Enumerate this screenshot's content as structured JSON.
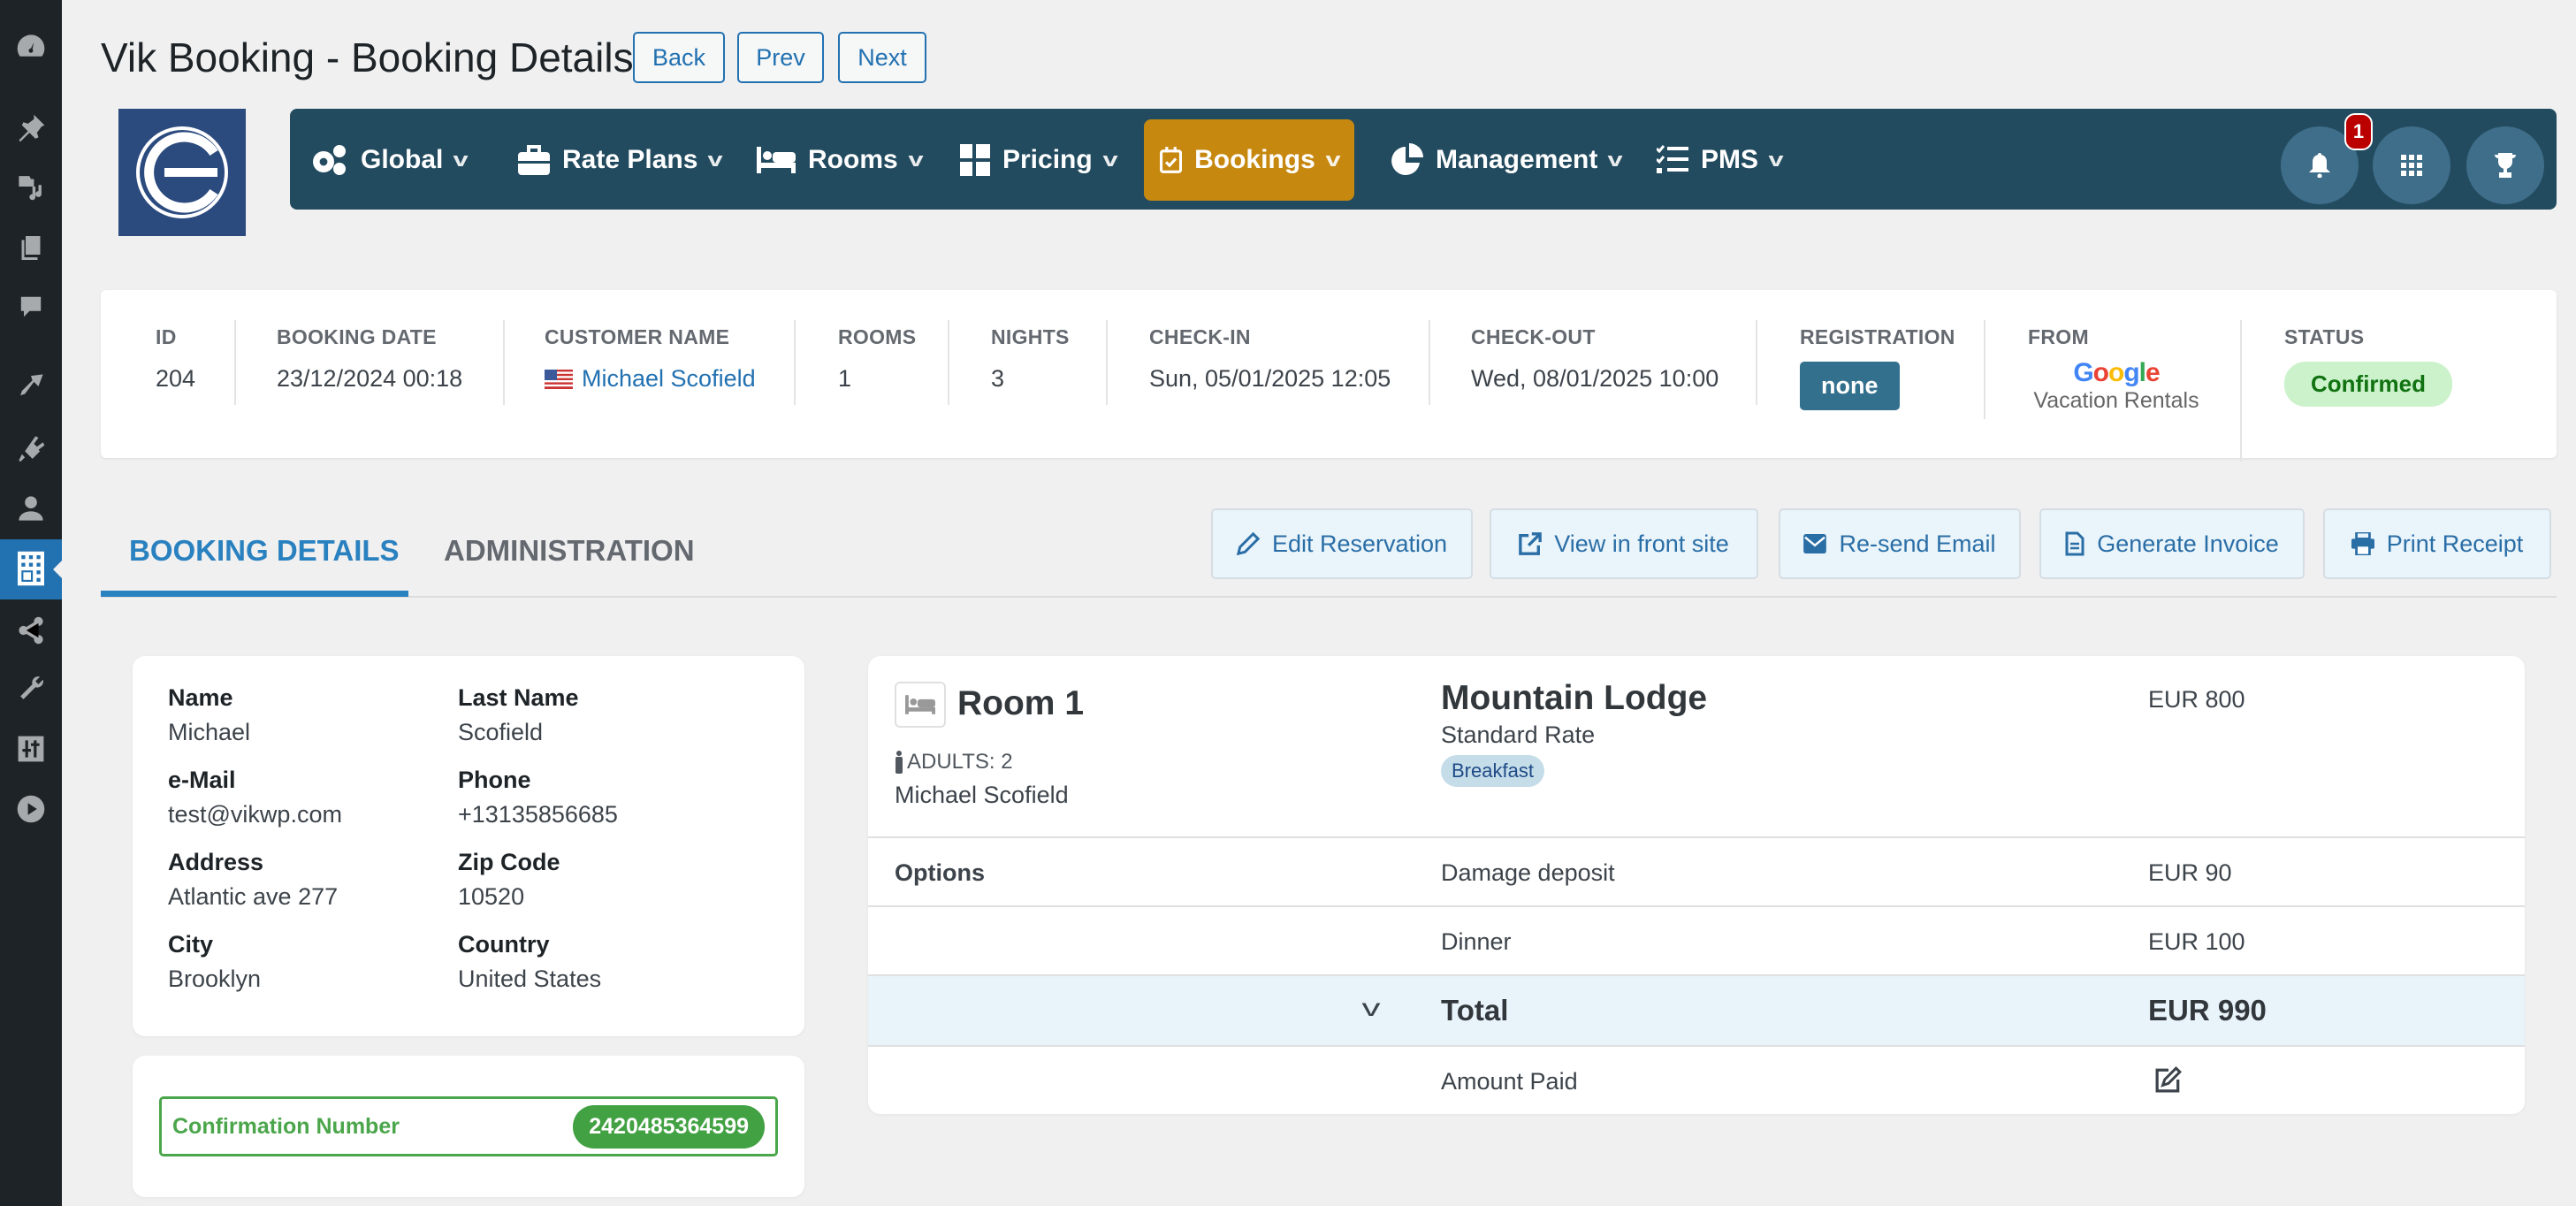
{
  "page": {
    "title": "Vik Booking - Booking Details"
  },
  "header_buttons": {
    "back": "Back",
    "prev": "Prev",
    "next": "Next"
  },
  "wp_sidebar": {
    "icons": [
      "dashboard-icon",
      "pin-icon",
      "media-icon",
      "pages-icon",
      "comments-icon",
      "appearance-icon",
      "plugins-icon",
      "users-icon",
      "vikbooking-icon",
      "share-icon",
      "tools-icon",
      "settings-icon",
      "play-icon"
    ],
    "active": "vikbooking-icon"
  },
  "menu": {
    "items": [
      {
        "label": "Global",
        "icon": "gears-icon"
      },
      {
        "label": "Rate Plans",
        "icon": "briefcase-icon"
      },
      {
        "label": "Rooms",
        "icon": "bed-icon"
      },
      {
        "label": "Pricing",
        "icon": "calculator-icon"
      },
      {
        "label": "Bookings",
        "icon": "calendar-check-icon",
        "active": true
      },
      {
        "label": "Management",
        "icon": "pie-chart-icon"
      },
      {
        "label": "PMS",
        "icon": "checklist-icon"
      }
    ],
    "notification_count": "1",
    "colors": {
      "bar": "#234b5f",
      "active": "#c6880f"
    }
  },
  "summary": {
    "id": {
      "label": "ID",
      "value": "204"
    },
    "booking_date": {
      "label": "BOOKING DATE",
      "value": "23/12/2024 00:18"
    },
    "customer_name": {
      "label": "CUSTOMER NAME",
      "value": "Michael Scofield",
      "flag": "us-flag"
    },
    "rooms": {
      "label": "ROOMS",
      "value": "1"
    },
    "nights": {
      "label": "NIGHTS",
      "value": "3"
    },
    "checkin": {
      "label": "CHECK-IN",
      "value": "Sun, 05/01/2025 12:05"
    },
    "checkout": {
      "label": "CHECK-OUT",
      "value": "Wed, 08/01/2025 10:00"
    },
    "registration": {
      "label": "REGISTRATION",
      "value": "none"
    },
    "from": {
      "label": "FROM",
      "brand": "Google",
      "sub": "Vacation Rentals"
    },
    "status": {
      "label": "STATUS",
      "value": "Confirmed",
      "color": "#117211"
    }
  },
  "tabs": [
    {
      "label": "BOOKING DETAILS",
      "active": true
    },
    {
      "label": "ADMINISTRATION"
    }
  ],
  "actions": {
    "edit": "Edit Reservation",
    "view": "View in front site",
    "resend": "Re-send Email",
    "invoice": "Generate Invoice",
    "print": "Print Receipt"
  },
  "customer": {
    "fields": [
      {
        "label": "Name",
        "value": "Michael"
      },
      {
        "label": "Last Name",
        "value": "Scofield"
      },
      {
        "label": "e-Mail",
        "value": "test@vikwp.com"
      },
      {
        "label": "Phone",
        "value": "+13135856685"
      },
      {
        "label": "Address",
        "value": "Atlantic ave 277"
      },
      {
        "label": "Zip Code",
        "value": "10520"
      },
      {
        "label": "City",
        "value": "Brooklyn"
      },
      {
        "label": "Country",
        "value": "United States"
      }
    ],
    "confirmation": {
      "label": "Confirmation Number",
      "value": "2420485364599"
    }
  },
  "room": {
    "title": "Room 1",
    "adults": "ADULTS: 2",
    "guest": "Michael Scofield",
    "name": "Mountain Lodge",
    "rate": "Standard Rate",
    "tag": "Breakfast",
    "price": "EUR 800",
    "options_label": "Options",
    "options": [
      {
        "name": "Damage deposit",
        "price": "EUR 90"
      },
      {
        "name": "Dinner",
        "price": "EUR 100"
      }
    ],
    "total_label": "Total",
    "total": "EUR 990",
    "amount_paid_label": "Amount Paid"
  }
}
